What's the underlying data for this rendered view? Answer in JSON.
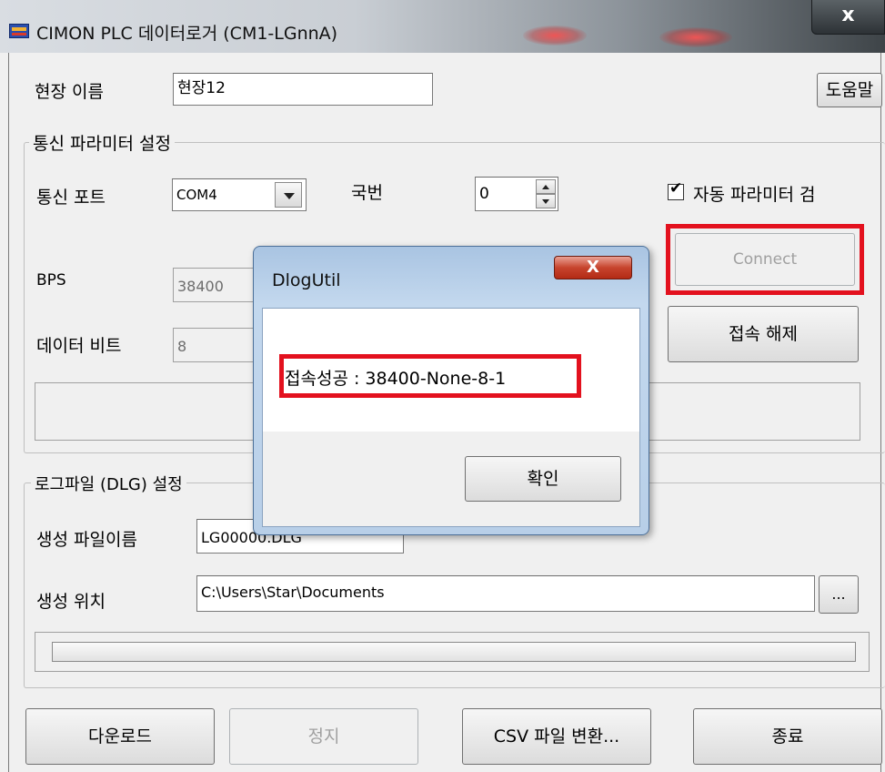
{
  "window": {
    "title": "CIMON PLC 데이터로거 (CM1-LGnnA)",
    "close_label": "x"
  },
  "site": {
    "label": "현장 이름",
    "value": "현장12",
    "help_label": "도움말"
  },
  "comm": {
    "group_label": "통신 파라미터 설정",
    "port_label": "통신 포트",
    "port_value": "COM4",
    "station_label": "국번",
    "station_value": "0",
    "auto_label": "자동 파라미터 검",
    "auto_checked": true,
    "bps_label": "BPS",
    "bps_value": "38400",
    "databits_label": "데이터 비트",
    "databits_value": "8",
    "connect_label": "Connect",
    "disconnect_label": "접속 해제"
  },
  "log": {
    "group_label": "로그파일 (DLG) 설정",
    "filename_label": "생성 파일이름",
    "filename_value": "LG00000.DLG",
    "location_label": "생성 위치",
    "location_value": "C:\\Users\\Star\\Documents",
    "browse_label": "..."
  },
  "buttons": {
    "download": "다운로드",
    "stop": "정지",
    "csv": "CSV 파일 변환...",
    "exit": "종료"
  },
  "dialog": {
    "title": "DlogUtil",
    "close_label": "X",
    "message": "접속성공 : 38400-None-8-1",
    "ok_label": "확인"
  },
  "colors": {
    "highlight": "#e3111e"
  }
}
